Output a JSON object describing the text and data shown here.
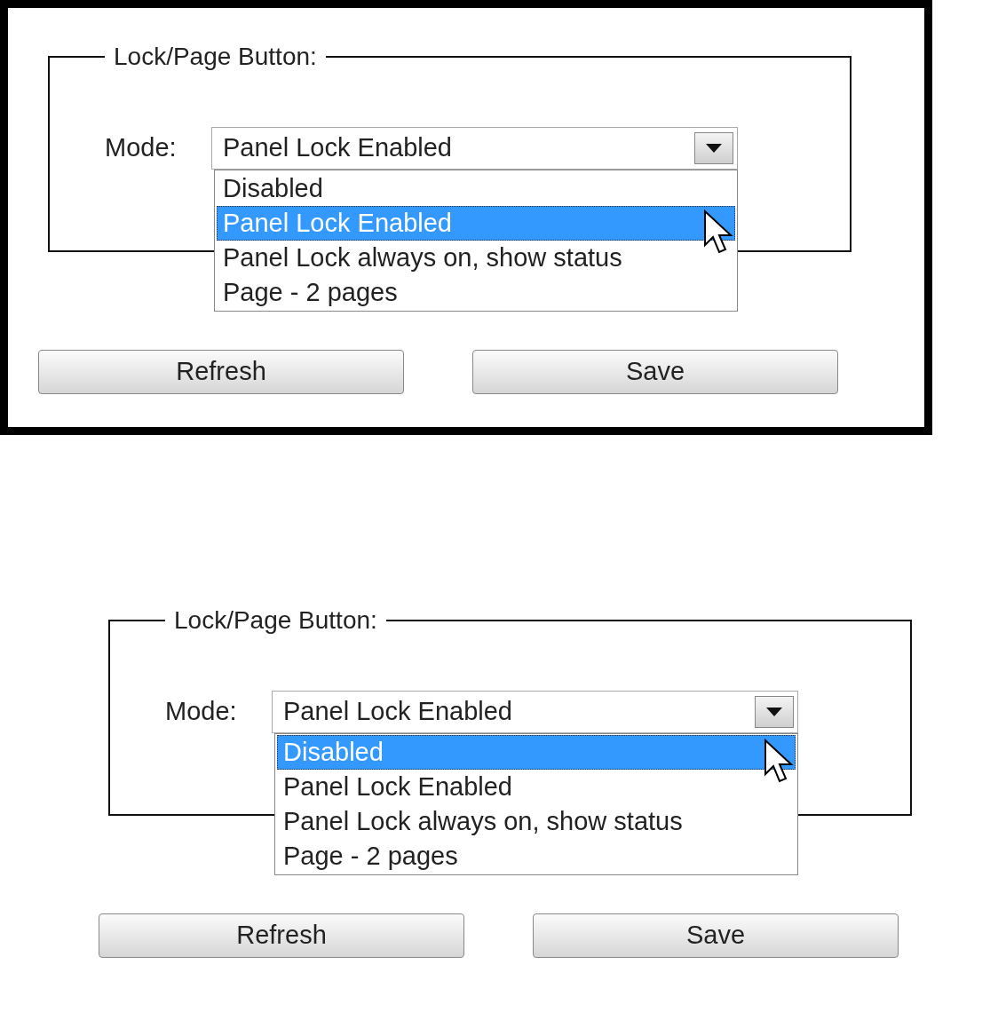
{
  "panels": [
    {
      "framed": true,
      "legend": "Lock/Page Button:",
      "mode_label": "Mode:",
      "select": {
        "value": "Panel Lock Enabled",
        "expanded": true
      },
      "options": [
        {
          "label": "Disabled",
          "selected": false
        },
        {
          "label": "Panel Lock Enabled",
          "selected": true
        },
        {
          "label": "Panel Lock always on, show status",
          "selected": false
        },
        {
          "label": "Page - 2 pages",
          "selected": false
        }
      ],
      "buttons": [
        "Refresh",
        "Save"
      ]
    },
    {
      "framed": false,
      "legend": "Lock/Page Button:",
      "mode_label": "Mode:",
      "select": {
        "value": "Panel Lock Enabled",
        "expanded": true
      },
      "options": [
        {
          "label": "Disabled",
          "selected": true
        },
        {
          "label": "Panel Lock Enabled",
          "selected": false
        },
        {
          "label": "Panel Lock always on, show status",
          "selected": false
        },
        {
          "label": "Page - 2 pages",
          "selected": false
        }
      ],
      "buttons": [
        "Refresh",
        "Save"
      ]
    }
  ]
}
